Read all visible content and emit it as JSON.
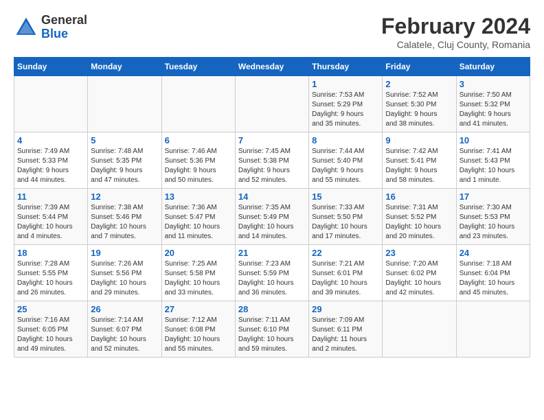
{
  "header": {
    "logo_general": "General",
    "logo_blue": "Blue",
    "month_year": "February 2024",
    "location": "Calatele, Cluj County, Romania"
  },
  "weekdays": [
    "Sunday",
    "Monday",
    "Tuesday",
    "Wednesday",
    "Thursday",
    "Friday",
    "Saturday"
  ],
  "weeks": [
    [
      {
        "day": "",
        "info": ""
      },
      {
        "day": "",
        "info": ""
      },
      {
        "day": "",
        "info": ""
      },
      {
        "day": "",
        "info": ""
      },
      {
        "day": "1",
        "info": "Sunrise: 7:53 AM\nSunset: 5:29 PM\nDaylight: 9 hours\nand 35 minutes."
      },
      {
        "day": "2",
        "info": "Sunrise: 7:52 AM\nSunset: 5:30 PM\nDaylight: 9 hours\nand 38 minutes."
      },
      {
        "day": "3",
        "info": "Sunrise: 7:50 AM\nSunset: 5:32 PM\nDaylight: 9 hours\nand 41 minutes."
      }
    ],
    [
      {
        "day": "4",
        "info": "Sunrise: 7:49 AM\nSunset: 5:33 PM\nDaylight: 9 hours\nand 44 minutes."
      },
      {
        "day": "5",
        "info": "Sunrise: 7:48 AM\nSunset: 5:35 PM\nDaylight: 9 hours\nand 47 minutes."
      },
      {
        "day": "6",
        "info": "Sunrise: 7:46 AM\nSunset: 5:36 PM\nDaylight: 9 hours\nand 50 minutes."
      },
      {
        "day": "7",
        "info": "Sunrise: 7:45 AM\nSunset: 5:38 PM\nDaylight: 9 hours\nand 52 minutes."
      },
      {
        "day": "8",
        "info": "Sunrise: 7:44 AM\nSunset: 5:40 PM\nDaylight: 9 hours\nand 55 minutes."
      },
      {
        "day": "9",
        "info": "Sunrise: 7:42 AM\nSunset: 5:41 PM\nDaylight: 9 hours\nand 58 minutes."
      },
      {
        "day": "10",
        "info": "Sunrise: 7:41 AM\nSunset: 5:43 PM\nDaylight: 10 hours\nand 1 minute."
      }
    ],
    [
      {
        "day": "11",
        "info": "Sunrise: 7:39 AM\nSunset: 5:44 PM\nDaylight: 10 hours\nand 4 minutes."
      },
      {
        "day": "12",
        "info": "Sunrise: 7:38 AM\nSunset: 5:46 PM\nDaylight: 10 hours\nand 7 minutes."
      },
      {
        "day": "13",
        "info": "Sunrise: 7:36 AM\nSunset: 5:47 PM\nDaylight: 10 hours\nand 11 minutes."
      },
      {
        "day": "14",
        "info": "Sunrise: 7:35 AM\nSunset: 5:49 PM\nDaylight: 10 hours\nand 14 minutes."
      },
      {
        "day": "15",
        "info": "Sunrise: 7:33 AM\nSunset: 5:50 PM\nDaylight: 10 hours\nand 17 minutes."
      },
      {
        "day": "16",
        "info": "Sunrise: 7:31 AM\nSunset: 5:52 PM\nDaylight: 10 hours\nand 20 minutes."
      },
      {
        "day": "17",
        "info": "Sunrise: 7:30 AM\nSunset: 5:53 PM\nDaylight: 10 hours\nand 23 minutes."
      }
    ],
    [
      {
        "day": "18",
        "info": "Sunrise: 7:28 AM\nSunset: 5:55 PM\nDaylight: 10 hours\nand 26 minutes."
      },
      {
        "day": "19",
        "info": "Sunrise: 7:26 AM\nSunset: 5:56 PM\nDaylight: 10 hours\nand 29 minutes."
      },
      {
        "day": "20",
        "info": "Sunrise: 7:25 AM\nSunset: 5:58 PM\nDaylight: 10 hours\nand 33 minutes."
      },
      {
        "day": "21",
        "info": "Sunrise: 7:23 AM\nSunset: 5:59 PM\nDaylight: 10 hours\nand 36 minutes."
      },
      {
        "day": "22",
        "info": "Sunrise: 7:21 AM\nSunset: 6:01 PM\nDaylight: 10 hours\nand 39 minutes."
      },
      {
        "day": "23",
        "info": "Sunrise: 7:20 AM\nSunset: 6:02 PM\nDaylight: 10 hours\nand 42 minutes."
      },
      {
        "day": "24",
        "info": "Sunrise: 7:18 AM\nSunset: 6:04 PM\nDaylight: 10 hours\nand 45 minutes."
      }
    ],
    [
      {
        "day": "25",
        "info": "Sunrise: 7:16 AM\nSunset: 6:05 PM\nDaylight: 10 hours\nand 49 minutes."
      },
      {
        "day": "26",
        "info": "Sunrise: 7:14 AM\nSunset: 6:07 PM\nDaylight: 10 hours\nand 52 minutes."
      },
      {
        "day": "27",
        "info": "Sunrise: 7:12 AM\nSunset: 6:08 PM\nDaylight: 10 hours\nand 55 minutes."
      },
      {
        "day": "28",
        "info": "Sunrise: 7:11 AM\nSunset: 6:10 PM\nDaylight: 10 hours\nand 59 minutes."
      },
      {
        "day": "29",
        "info": "Sunrise: 7:09 AM\nSunset: 6:11 PM\nDaylight: 11 hours\nand 2 minutes."
      },
      {
        "day": "",
        "info": ""
      },
      {
        "day": "",
        "info": ""
      }
    ]
  ]
}
